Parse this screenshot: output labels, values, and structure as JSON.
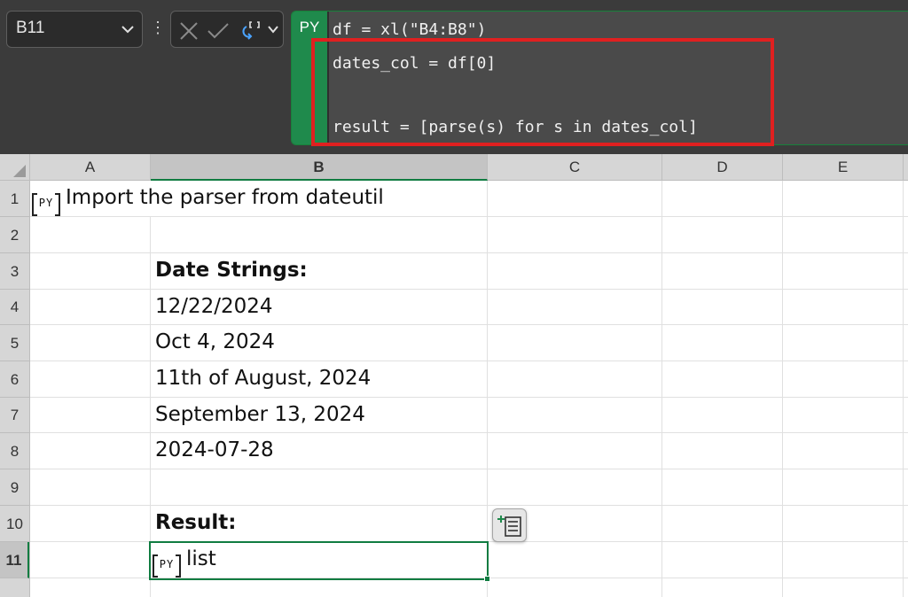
{
  "name_box": {
    "value": "B11"
  },
  "formula_bar": {
    "python_tab_label": "PY",
    "code_lines": [
      "df = xl(\"B4:B8\")",
      "dates_col = df[0]",
      "",
      "result = [parse(s) for s in dates_col]"
    ]
  },
  "columns": [
    "A",
    "B",
    "C",
    "D",
    "E"
  ],
  "rows": [
    "1",
    "2",
    "3",
    "4",
    "5",
    "6",
    "7",
    "8",
    "9",
    "10",
    "11",
    ""
  ],
  "cells": {
    "A1": {
      "badge": "PY",
      "text": "Import the parser from dateutil"
    },
    "B3": "Date Strings:",
    "B4": "12/22/2024",
    "B5": "Oct 4, 2024",
    "B6": "11th of August, 2024",
    "B7": "September 13, 2024",
    "B8": "2024-07-28",
    "B10": "Result:",
    "B11": {
      "badge": "PY",
      "text": "list"
    }
  },
  "colors": {
    "accent_green": "#107c41",
    "python_green": "#1f8a4c",
    "highlight_red": "#e02020"
  }
}
